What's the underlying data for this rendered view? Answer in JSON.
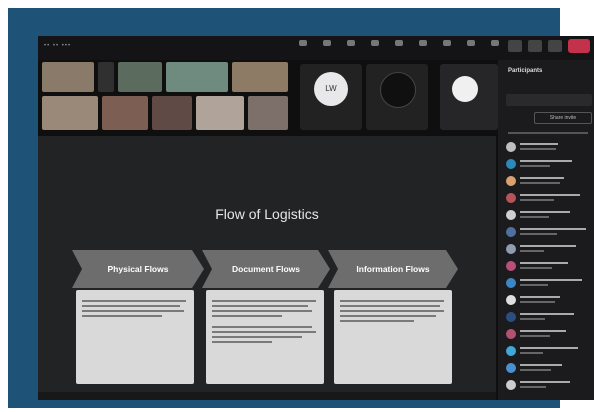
{
  "window": {
    "app_label": "•• •• •••"
  },
  "toolbar": {
    "buttons": [
      "",
      "",
      "",
      "",
      "",
      "",
      "",
      "",
      ""
    ]
  },
  "presenters": [
    {
      "initials": "LW",
      "color": "#e8e8ea"
    },
    {
      "initials": "",
      "color": "#101010"
    }
  ],
  "slide": {
    "title": "Flow of Logistics",
    "columns": [
      {
        "heading": "Physical Flows",
        "color": "#6d6d6d"
      },
      {
        "heading": "Document Flows",
        "color": "#6d6d6d"
      },
      {
        "heading": "Information Flows",
        "color": "#6d6d6d"
      }
    ]
  },
  "participants": {
    "title": "Participants",
    "share_label": "Share invite",
    "avatar_colors": [
      "#bfbfbf",
      "#2b8ab8",
      "#d9a070",
      "#b6545a",
      "#cfcfcf",
      "#4f6fa0",
      "#8f9bb0",
      "#b94f78",
      "#3c86c5",
      "#dedede",
      "#2c4e7e",
      "#b35270",
      "#41a8d6",
      "#4a8fcf",
      "#cccccc"
    ]
  }
}
